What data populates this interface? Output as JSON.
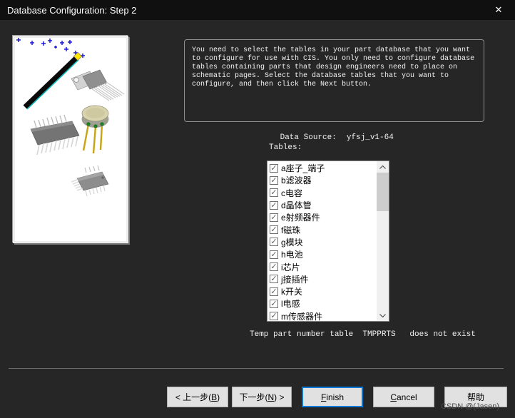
{
  "window": {
    "title": "Database Configuration: Step 2",
    "close_glyph": "✕"
  },
  "instructions": "You need to select the tables in your part database that you want to configure for use with CIS. You only need to configure database tables containing parts that design engineers need to place on schematic pages. Select the database tables that you want to configure, and then click the Next button.",
  "data_source": {
    "label": "Data Source:",
    "value": "yfsj_v1-64"
  },
  "tables": {
    "label": "Tables:",
    "items": [
      {
        "label": "a座子_端子",
        "checked": true
      },
      {
        "label": "b滤波器",
        "checked": true
      },
      {
        "label": "c电容",
        "checked": true
      },
      {
        "label": "d晶体管",
        "checked": true
      },
      {
        "label": "e射频器件",
        "checked": true
      },
      {
        "label": "f磁珠",
        "checked": true
      },
      {
        "label": "g模块",
        "checked": true
      },
      {
        "label": "h电池",
        "checked": true
      },
      {
        "label": "i芯片",
        "checked": true
      },
      {
        "label": "j接插件",
        "checked": true
      },
      {
        "label": "k开关",
        "checked": true
      },
      {
        "label": "l电感",
        "checked": true
      },
      {
        "label": "m传感器件",
        "checked": true
      }
    ]
  },
  "temp_note": "Temp part number table  TMPPRTS   does not exist",
  "buttons": {
    "back": {
      "pre": "< 上一步(",
      "key": "B",
      "post": ")"
    },
    "next": {
      "pre": "下一步(",
      "key": "N",
      "post": ") >"
    },
    "finish": {
      "pre": "",
      "key": "F",
      "post": "inish"
    },
    "cancel": {
      "pre": "",
      "key": "C",
      "post": "ancel"
    },
    "help": {
      "pre": "帮助",
      "key": "",
      "post": ""
    }
  },
  "watermark": "CSDN @(Jasen)",
  "colors": {
    "titlebar_bg": "#101010",
    "dialog_bg": "#262626",
    "text_light": "#f2f2f2",
    "listbox_bg": "#ffffff",
    "button_bg": "#e1e1e1",
    "default_button_border": "#0078d7",
    "scroll_track": "#f0f0f0",
    "scroll_thumb": "#cdcdcd",
    "plus_marks": "#1a1acd"
  }
}
